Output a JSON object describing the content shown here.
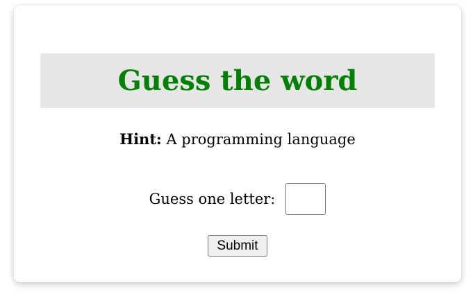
{
  "game": {
    "title": "Guess the word",
    "hint_label": "Hint:",
    "hint_text": "A programming language",
    "guess_label": "Guess one letter:",
    "guess_input_value": "",
    "submit_label": "Submit"
  },
  "colors": {
    "title": "#008000",
    "title_bar_background": "#e6e6e6",
    "card_background": "#ffffff"
  }
}
